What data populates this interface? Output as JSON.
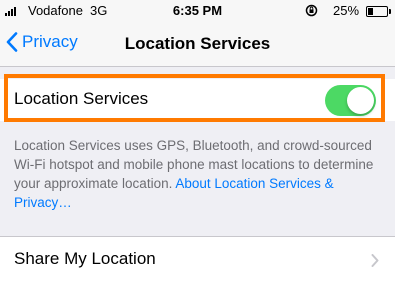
{
  "status_bar": {
    "carrier": "Vodafone",
    "network": "3G",
    "time": "6:35 PM",
    "battery_percent": "25%",
    "battery_level": 0.25,
    "icons": [
      "signal-bars-icon",
      "rotation-lock-icon",
      "battery-icon"
    ]
  },
  "nav": {
    "back_label": "Privacy",
    "title": "Location Services"
  },
  "location_toggle": {
    "label": "Location Services",
    "state": "on",
    "on_color": "#4cd964"
  },
  "description": {
    "text": "Location Services uses GPS, Bluetooth, and crowd-sourced Wi-Fi hotspot and mobile phone mast locations to determine your approximate location. ",
    "link_text": "About Location Services & Privacy…"
  },
  "share_my_location": {
    "label": "Share My Location"
  },
  "colors": {
    "accent": "#007aff",
    "highlight": "#ff7a00",
    "background": "#efeff4"
  }
}
